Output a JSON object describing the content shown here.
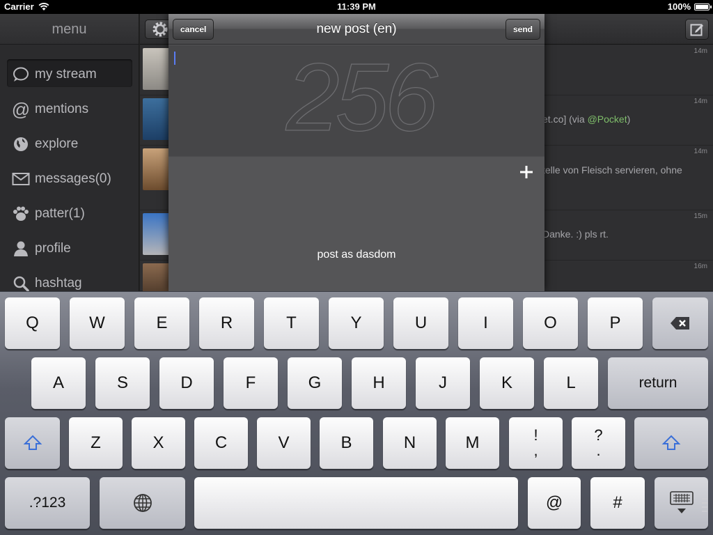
{
  "status": {
    "carrier": "Carrier",
    "time": "11:39 PM",
    "battery": "100%"
  },
  "menu": {
    "title": "menu",
    "items": [
      {
        "label": "my stream",
        "icon": "speech-bubble-icon",
        "active": true
      },
      {
        "label": "mentions",
        "icon": "at-icon"
      },
      {
        "label": "explore",
        "icon": "globe-icon"
      },
      {
        "label": "messages(0)",
        "icon": "envelope-icon"
      },
      {
        "label": "patter(1)",
        "icon": "paw-icon"
      },
      {
        "label": "profile",
        "icon": "person-icon"
      },
      {
        "label": "hashtag",
        "icon": "search-icon"
      }
    ]
  },
  "stream": {
    "rows": [
      {
        "time": "14m",
        "text": "",
        "link": "",
        "tail": ""
      },
      {
        "time": "14m",
        "text": "et.co] (via ",
        "link": "@Pocket",
        "tail": ")"
      },
      {
        "time": "14m",
        "text": "telle von Fleisch servieren, ohne",
        "link": "",
        "tail": ""
      },
      {
        "time": "15m",
        "text": "Danke. :) pls rt.",
        "link": "",
        "tail": ""
      },
      {
        "time": "16m",
        "text": "",
        "link": "",
        "tail": ""
      }
    ]
  },
  "compose": {
    "title": "new post (en)",
    "cancel": "cancel",
    "send": "send",
    "counter": "256",
    "post_as": "post as dasdom"
  },
  "keyboard": {
    "row1": [
      "Q",
      "W",
      "E",
      "R",
      "T",
      "Y",
      "U",
      "I",
      "O",
      "P"
    ],
    "row2": [
      "A",
      "S",
      "D",
      "F",
      "G",
      "H",
      "J",
      "K",
      "L"
    ],
    "return": "return",
    "row3": [
      "Z",
      "X",
      "C",
      "V",
      "B",
      "N",
      "M"
    ],
    "excl": [
      "!",
      ","
    ],
    "quest": [
      "?",
      "."
    ],
    "numbers": ".?123",
    "at": "@",
    "hash": "#"
  }
}
